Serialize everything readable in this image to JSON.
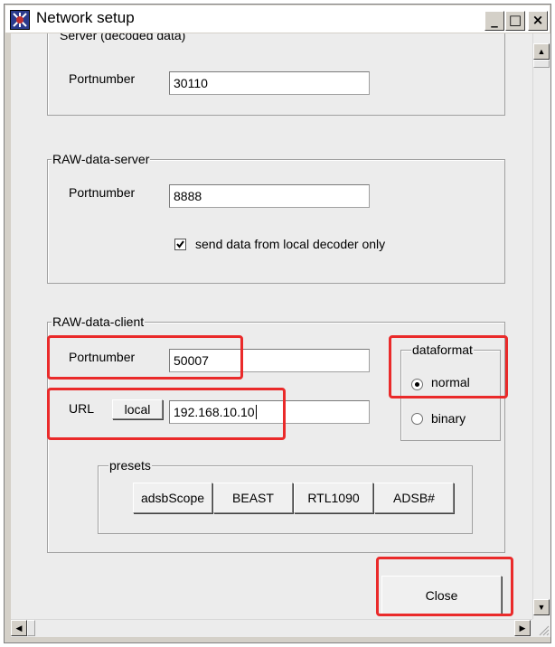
{
  "window": {
    "title": "Network setup",
    "minimize_glyph": "_",
    "maximize_glyph": "□",
    "close_glyph": "×"
  },
  "server_group": {
    "legend": "Server (decoded data)",
    "port_label": "Portnumber",
    "port_value": "30110"
  },
  "raw_server_group": {
    "legend": "RAW-data-server",
    "port_label": "Portnumber",
    "port_value": "8888",
    "local_only_label": "send data from local decoder only",
    "local_only_checked": true
  },
  "raw_client_group": {
    "legend": "RAW-data-client",
    "port_label": "Portnumber",
    "port_value": "50007",
    "url_label": "URL",
    "local_button": "local",
    "url_value": "192.168.10.10",
    "dataformat": {
      "legend": "dataformat",
      "options": [
        "normal",
        "binary"
      ],
      "selected": "normal"
    },
    "presets": {
      "legend": "presets",
      "buttons": [
        "adsbScope",
        "BEAST",
        "RTL1090",
        "ADSB#"
      ]
    }
  },
  "close_button": "Close",
  "icons": {
    "app": "app-icon",
    "scroll_up": "arrow-up-icon",
    "scroll_down": "arrow-down-icon",
    "scroll_left": "arrow-left-icon",
    "scroll_right": "arrow-right-icon",
    "grip": "resize-grip-icon"
  },
  "highlight_color": "#ea2a2a"
}
